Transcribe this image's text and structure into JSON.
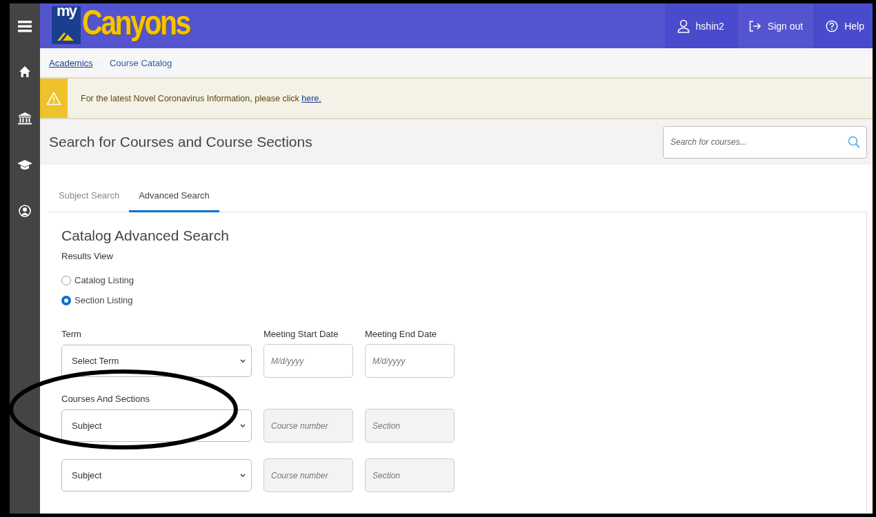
{
  "header": {
    "logo": {
      "prefix": "my",
      "name": "Canyons"
    },
    "user": "hshin2",
    "actions": [
      {
        "kind": "signout",
        "label": "Sign out"
      },
      {
        "kind": "help",
        "label": "Help"
      }
    ]
  },
  "breadcrumb": {
    "separator": "·",
    "items": [
      {
        "label": "Academics",
        "link": true
      },
      {
        "label": "Course Catalog",
        "link": false
      }
    ]
  },
  "alert": {
    "text": "For the latest Novel Coronavirus Information, please click",
    "link": "here."
  },
  "page_title": "Search for Courses and Course Sections",
  "search": {
    "placeholder": "Search for courses..."
  },
  "tabs": [
    {
      "label": "Subject Search",
      "selected": false
    },
    {
      "label": "Advanced Search",
      "selected": true
    }
  ],
  "form": {
    "title": "Catalog Advanced Search",
    "results_view": {
      "label": "Results View",
      "options": [
        {
          "label": "Catalog Listing",
          "selected": false
        },
        {
          "label": "Section Listing",
          "selected": true
        }
      ]
    },
    "term": {
      "label": "Term",
      "value": "Select Term"
    },
    "start_date": {
      "label": "Meeting Start Date",
      "placeholder": "M/d/yyyy",
      "disabled": false
    },
    "end_date": {
      "label": "Meeting End Date",
      "placeholder": "M/d/yyyy",
      "disabled": false
    },
    "courses_label": "Courses And Sections",
    "course_rows": [
      {
        "subject": "Subject",
        "course": {
          "placeholder": "Course number",
          "disabled": true
        },
        "section": {
          "placeholder": "Section",
          "disabled": true
        },
        "annotated": true
      },
      {
        "subject": "Subject",
        "course": {
          "placeholder": "Course number",
          "disabled": true
        },
        "section": {
          "placeholder": "Section",
          "disabled": true
        },
        "annotated": false
      }
    ]
  }
}
